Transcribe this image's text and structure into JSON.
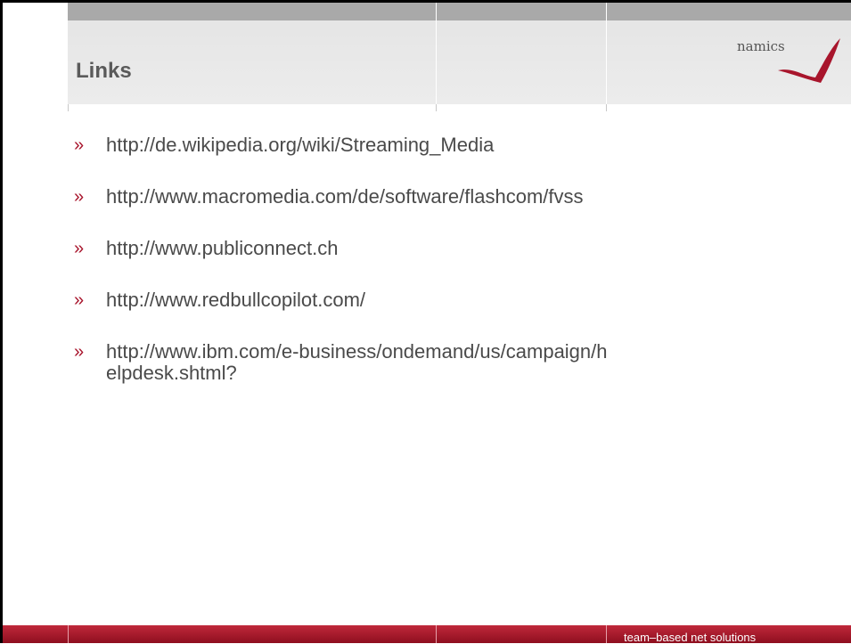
{
  "slide": {
    "title": "Links",
    "logo_text": "namics",
    "accent_color": "#a8152c",
    "bullet_symbol": "»",
    "links": [
      "http://de.wikipedia.org/wiki/Streaming_Media",
      "http://www.macromedia.com/de/software/flashcom/fvss",
      "http://www.publiconnect.ch",
      "http://www.redbullcopilot.com/",
      "http://www.ibm.com/e-business/ondemand/us/campaign/helpdesk.shtml?"
    ],
    "footer_text": "team–based net solutions"
  }
}
